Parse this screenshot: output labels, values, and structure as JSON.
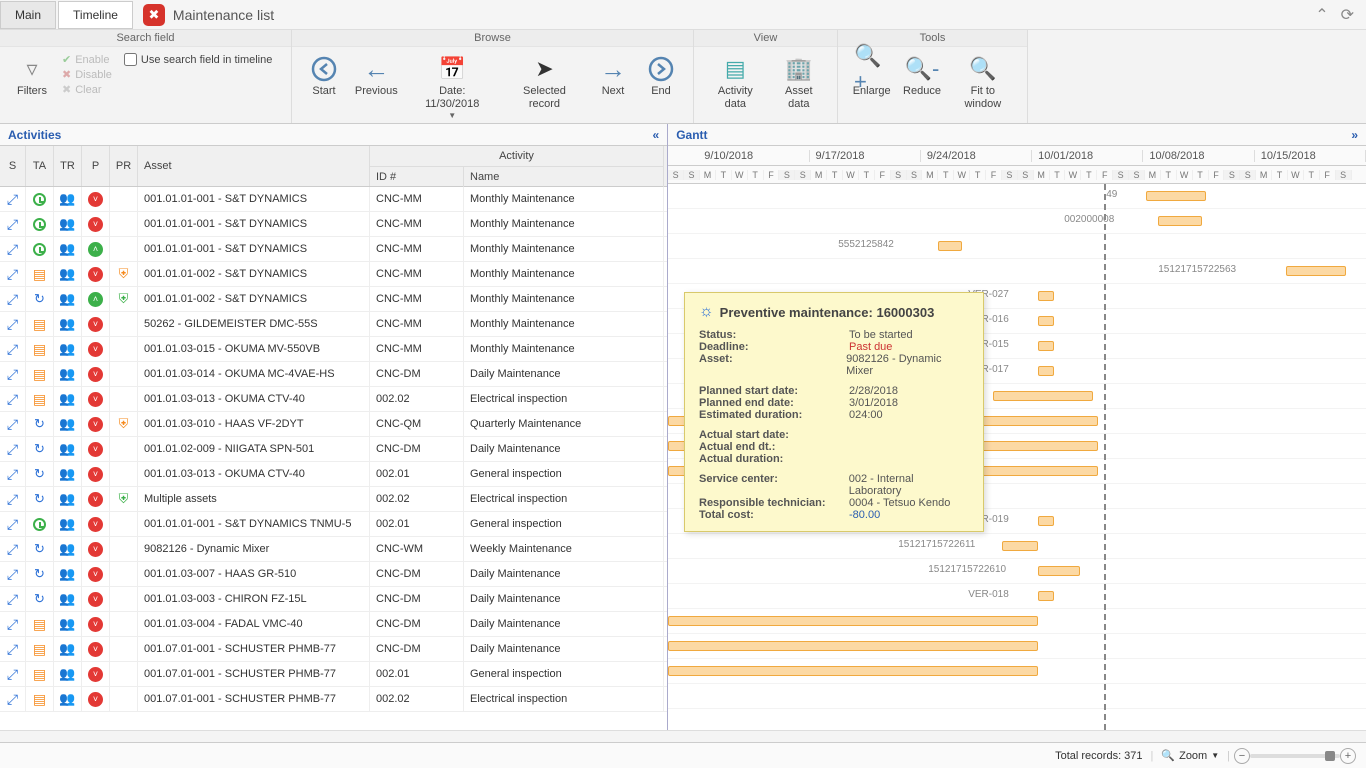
{
  "tabs": {
    "main": "Main",
    "timeline": "Timeline"
  },
  "page_title": "Maintenance list",
  "ribbon": {
    "groups": {
      "search": {
        "label": "Search field",
        "filters": "Filters",
        "enable": "Enable",
        "disable": "Disable",
        "clear": "Clear",
        "use_search_timeline": "Use search field in timeline"
      },
      "browse": {
        "label": "Browse",
        "start": "Start",
        "previous": "Previous",
        "date": "Date: 11/30/2018",
        "selected": "Selected record",
        "next": "Next",
        "end": "End"
      },
      "view": {
        "label": "View",
        "activity_data": "Activity data",
        "asset_data": "Asset data"
      },
      "tools": {
        "label": "Tools",
        "enlarge": "Enlarge",
        "reduce": "Reduce",
        "fit": "Fit to window"
      }
    }
  },
  "left": {
    "title": "Activities",
    "cols": {
      "s": "S",
      "ta": "TA",
      "tr": "TR",
      "p": "P",
      "pr": "PR",
      "asset": "Asset",
      "activity": "Activity",
      "id": "ID #",
      "name": "Name"
    },
    "rows": [
      {
        "ta": "clock",
        "p": "down",
        "pr": "",
        "asset": "001.01.01-001 - S&T DYNAMICS",
        "id": "CNC-MM",
        "name": "Monthly Maintenance"
      },
      {
        "ta": "clock",
        "p": "down",
        "pr": "",
        "asset": "001.01.01-001 - S&T DYNAMICS",
        "id": "CNC-MM",
        "name": "Monthly Maintenance"
      },
      {
        "ta": "clock",
        "p": "up",
        "pr": "",
        "asset": "001.01.01-001 - S&T DYNAMICS",
        "id": "CNC-MM",
        "name": "Monthly Maintenance"
      },
      {
        "ta": "clip",
        "p": "down",
        "pr": "shield",
        "asset": "001.01.01-002 - S&T DYNAMICS",
        "id": "CNC-MM",
        "name": "Monthly Maintenance"
      },
      {
        "ta": "refresh",
        "p": "up",
        "pr": "shield-g",
        "asset": "001.01.01-002 - S&T DYNAMICS",
        "id": "CNC-MM",
        "name": "Monthly Maintenance"
      },
      {
        "ta": "clip",
        "p": "down",
        "pr": "",
        "asset": "50262 - GILDEMEISTER DMC-55S",
        "id": "CNC-MM",
        "name": "Monthly Maintenance"
      },
      {
        "ta": "clip",
        "p": "down",
        "pr": "",
        "asset": "001.01.03-015 - OKUMA MV-550VB",
        "id": "CNC-MM",
        "name": "Monthly Maintenance"
      },
      {
        "ta": "clip",
        "p": "down",
        "pr": "",
        "asset": "001.01.03-014 - OKUMA MC-4VAE-HS",
        "id": "CNC-DM",
        "name": "Daily Maintenance"
      },
      {
        "ta": "clip",
        "p": "down",
        "pr": "",
        "asset": "001.01.03-013 - OKUMA CTV-40",
        "id": "002.02",
        "name": "Electrical inspection"
      },
      {
        "ta": "refresh",
        "p": "down",
        "pr": "shield",
        "asset": "001.01.03-010 - HAAS VF-2DYT",
        "id": "CNC-QM",
        "name": "Quarterly Maintenance"
      },
      {
        "ta": "refresh",
        "p": "down",
        "pr": "",
        "asset": "001.01.02-009 - NIIGATA SPN-501",
        "id": "CNC-DM",
        "name": "Daily Maintenance"
      },
      {
        "ta": "refresh",
        "p": "down",
        "pr": "",
        "asset": "001.01.03-013 - OKUMA CTV-40",
        "id": "002.01",
        "name": "General inspection"
      },
      {
        "ta": "refresh",
        "p": "down",
        "pr": "shield-g",
        "asset": "Multiple assets",
        "id": "002.02",
        "name": "Electrical inspection"
      },
      {
        "ta": "clock",
        "p": "down",
        "pr": "",
        "asset": "001.01.01-001 - S&T DYNAMICS TNMU-5",
        "id": "002.01",
        "name": "General inspection"
      },
      {
        "ta": "refresh",
        "p": "down",
        "pr": "",
        "asset": "9082126 - Dynamic Mixer",
        "id": "CNC-WM",
        "name": "Weekly Maintenance"
      },
      {
        "ta": "refresh",
        "p": "down",
        "pr": "",
        "asset": "001.01.03-007 - HAAS GR-510",
        "id": "CNC-DM",
        "name": "Daily Maintenance"
      },
      {
        "ta": "refresh",
        "p": "down",
        "pr": "",
        "asset": "001.01.03-003 - CHIRON FZ-15L",
        "id": "CNC-DM",
        "name": "Daily Maintenance"
      },
      {
        "ta": "clip",
        "p": "down",
        "pr": "",
        "asset": "001.01.03-004 - FADAL VMC-40",
        "id": "CNC-DM",
        "name": "Daily Maintenance"
      },
      {
        "ta": "clip",
        "p": "down",
        "pr": "",
        "asset": "001.07.01-001 - SCHUSTER PHMB-77",
        "id": "CNC-DM",
        "name": "Daily Maintenance"
      },
      {
        "ta": "clip",
        "p": "down",
        "pr": "",
        "asset": "001.07.01-001 - SCHUSTER PHMB-77",
        "id": "002.01",
        "name": "General inspection"
      },
      {
        "ta": "clip",
        "p": "down",
        "pr": "",
        "asset": "001.07.01-001 - SCHUSTER PHMB-77",
        "id": "002.02",
        "name": "Electrical inspection"
      }
    ]
  },
  "right": {
    "title": "Gantt",
    "weeks": [
      "9/10/2018",
      "9/17/2018",
      "9/24/2018",
      "10/01/2018",
      "10/08/2018",
      "10/15/2018"
    ],
    "days": [
      "S",
      "M",
      "T",
      "W",
      "T",
      "F",
      "S"
    ],
    "labels": {
      "r0": "49",
      "r2": "002000008",
      "r3": "5552125842",
      "r4": "15121715722563",
      "r5": "VER-027",
      "r6": "VER-016",
      "r7": "VER-015",
      "r8": "VER-017",
      "r14": "VER-019",
      "r15": "15121715722611",
      "r16": "15121715722610",
      "r17": "VER-018"
    }
  },
  "tooltip": {
    "title": "Preventive maintenance: 16000303",
    "rows": [
      {
        "lbl": "Status:",
        "val": "To be started"
      },
      {
        "lbl": "Deadline:",
        "val": "Past due",
        "cls": "red"
      },
      {
        "lbl": "Asset:",
        "val": "9082126 - Dynamic Mixer"
      }
    ],
    "rows2": [
      {
        "lbl": "Planned start date:",
        "val": "2/28/2018"
      },
      {
        "lbl": "Planned end date:",
        "val": "3/01/2018"
      },
      {
        "lbl": "Estimated duration:",
        "val": "024:00"
      }
    ],
    "rows3": [
      {
        "lbl": "Actual start date:",
        "val": ""
      },
      {
        "lbl": "Actual end dt.:",
        "val": ""
      },
      {
        "lbl": "Actual duration:",
        "val": ""
      }
    ],
    "rows4": [
      {
        "lbl": "Service center:",
        "val": "002 - Internal Laboratory"
      },
      {
        "lbl": "Responsible technician:",
        "val": "0004 - Tetsuo Kendo"
      },
      {
        "lbl": "Total cost:",
        "val": "-80.00",
        "cls": "blue"
      }
    ]
  },
  "status": {
    "total_records": "Total records: 371",
    "zoom": "Zoom"
  }
}
